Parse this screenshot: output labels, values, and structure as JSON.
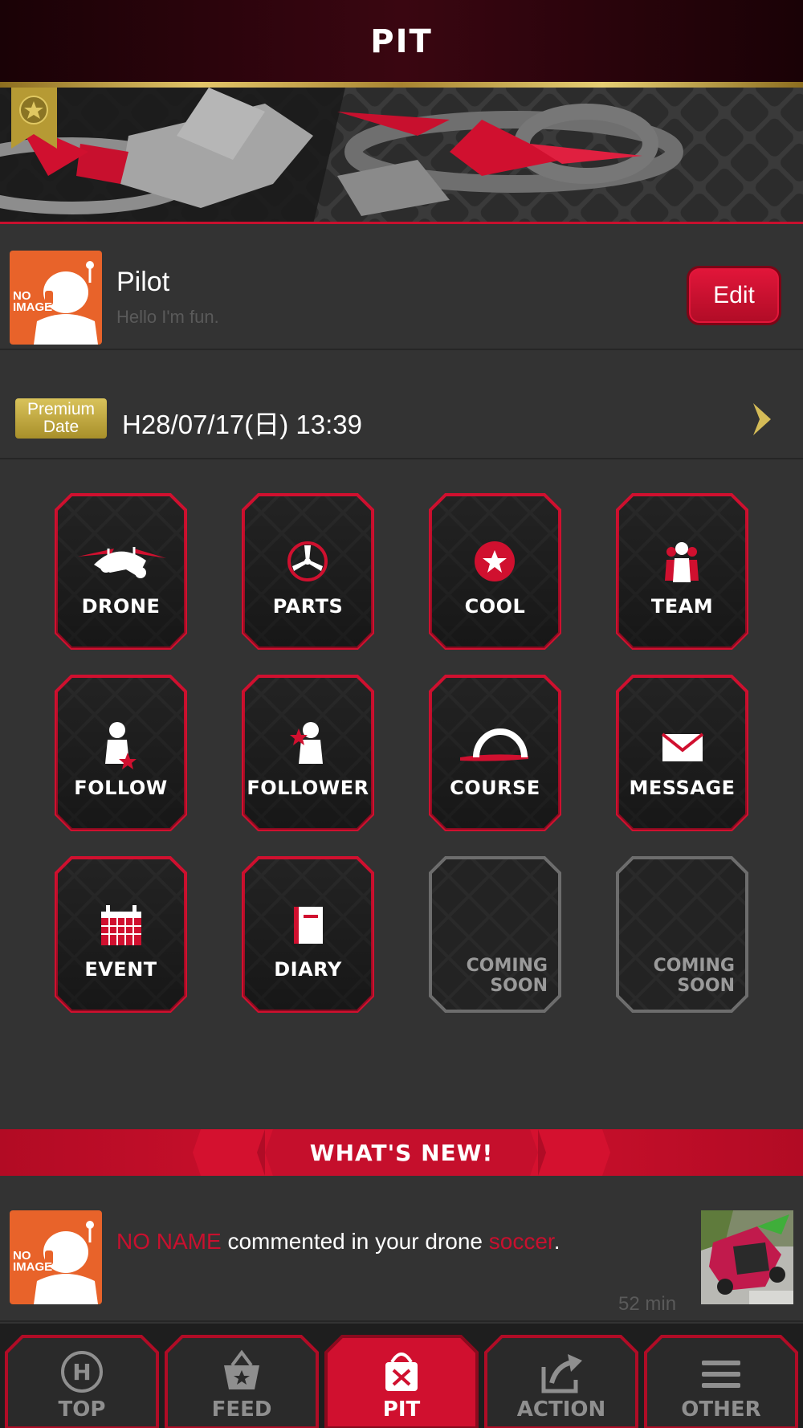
{
  "header": {
    "title": "PIT"
  },
  "profile": {
    "avatar_text_line1": "NO",
    "avatar_text_line2": "IMAGE",
    "name": "Pilot",
    "bio": "Hello I'm fun.",
    "edit_label": "Edit"
  },
  "premium": {
    "badge_line1": "Premium",
    "badge_line2": "Date",
    "date": "H28/07/17(日) 13:39"
  },
  "grid": {
    "drone": "DRONE",
    "parts": "PARTS",
    "cool": "COOL",
    "team": "TEAM",
    "follow": "FOLLOW",
    "follower": "FOLLOWER",
    "course": "COURSE",
    "message": "MESSAGE",
    "event": "EVENT",
    "diary": "DIARY",
    "soon1_line1": "COMING",
    "soon1_line2": "SOON",
    "soon2_line1": "COMING",
    "soon2_line2": "SOON"
  },
  "whats_new": {
    "title": "WHAT'S NEW!",
    "items": [
      {
        "user": "NO NAME",
        "text_middle": " commented in your drone ",
        "target": "soccer",
        "text_end": ".",
        "time": "52 min"
      }
    ]
  },
  "nav": {
    "top": "TOP",
    "feed": "FEED",
    "pit": "PIT",
    "action": "ACTION",
    "other": "OTHER"
  },
  "colors": {
    "accent": "#c8102e",
    "gold": "#d4bb57",
    "background": "#333333",
    "avatar_orange": "#e8632a"
  },
  "icons": [
    "star-ribbon-icon",
    "drone-icon",
    "propeller-icon",
    "star-circle-icon",
    "team-icon",
    "follow-icon",
    "follower-icon",
    "course-icon",
    "envelope-icon",
    "calendar-icon",
    "diary-icon",
    "chevron-right-icon",
    "helipad-icon",
    "basket-icon",
    "bag-icon",
    "share-icon",
    "menu-icon"
  ]
}
